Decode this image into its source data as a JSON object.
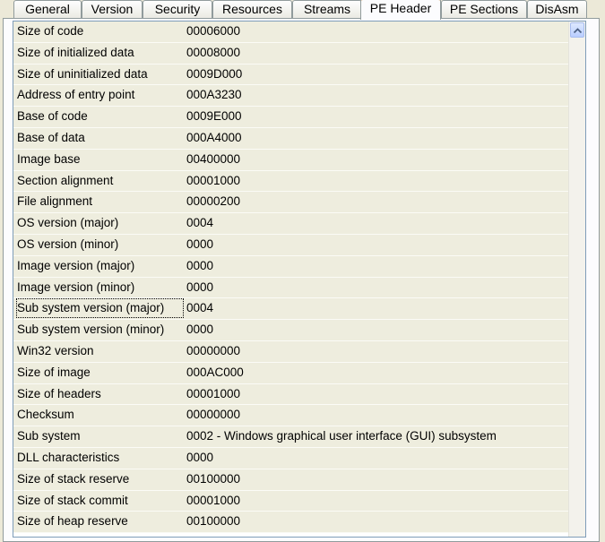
{
  "tabs": [
    {
      "label": "General"
    },
    {
      "label": "Version"
    },
    {
      "label": "Security"
    },
    {
      "label": "Resources"
    },
    {
      "label": "Streams"
    },
    {
      "label": "PE Header"
    },
    {
      "label": "PE Sections"
    },
    {
      "label": "DisAsm"
    }
  ],
  "active_tab": "PE Header",
  "rows": [
    {
      "name": "Size of code",
      "value": "00006000"
    },
    {
      "name": "Size of initialized data",
      "value": "00008000"
    },
    {
      "name": "Size of uninitialized data",
      "value": "0009D000"
    },
    {
      "name": "Address of entry point",
      "value": "000A3230"
    },
    {
      "name": "Base of code",
      "value": "0009E000"
    },
    {
      "name": "Base of data",
      "value": "000A4000"
    },
    {
      "name": "Image base",
      "value": "00400000"
    },
    {
      "name": "Section alignment",
      "value": "00001000"
    },
    {
      "name": "File alignment",
      "value": "00000200"
    },
    {
      "name": "OS version (major)",
      "value": "0004"
    },
    {
      "name": "OS version (minor)",
      "value": "0000"
    },
    {
      "name": "Image version (major)",
      "value": "0000"
    },
    {
      "name": "Image version (minor)",
      "value": "0000"
    },
    {
      "name": "Sub system version (major)",
      "value": "0004"
    },
    {
      "name": "Sub system version (minor)",
      "value": "0000"
    },
    {
      "name": "Win32 version",
      "value": "00000000"
    },
    {
      "name": "Size of image",
      "value": "000AC000"
    },
    {
      "name": "Size of headers",
      "value": "00001000"
    },
    {
      "name": "Checksum",
      "value": "00000000"
    },
    {
      "name": "Sub system",
      "value": "0002 - Windows graphical user interface (GUI) subsystem"
    },
    {
      "name": "DLL characteristics",
      "value": "0000"
    },
    {
      "name": "Size of stack reserve",
      "value": "00100000"
    },
    {
      "name": "Size of stack commit",
      "value": "00001000"
    },
    {
      "name": "Size of heap reserve",
      "value": "00100000"
    }
  ],
  "focused_row": "Sub system version (major)",
  "scrollbar": {
    "up_icon": "arrow-up-icon"
  },
  "colors": {
    "row_bg": "#eeedde",
    "active_tab_accent": "#e68b2c",
    "border": "#7f9db9"
  }
}
